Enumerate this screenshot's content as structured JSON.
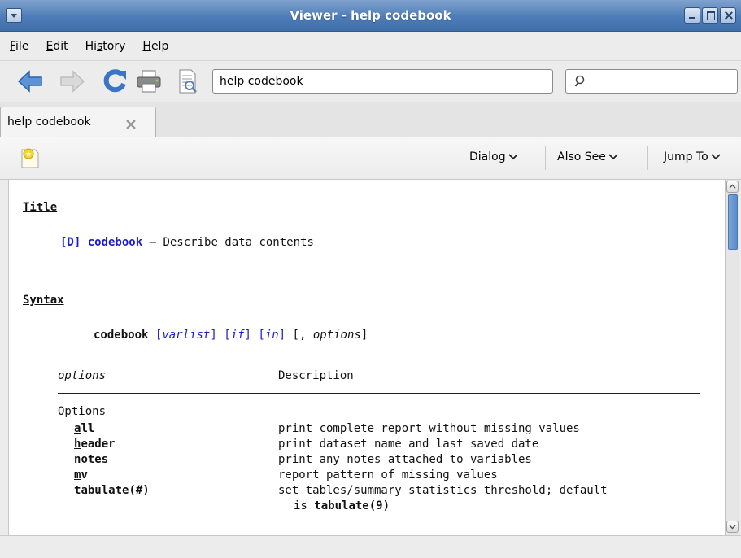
{
  "window": {
    "title": "Viewer - help codebook"
  },
  "menu": [
    {
      "pre": "",
      "key": "F",
      "post": "ile"
    },
    {
      "pre": "",
      "key": "E",
      "post": "dit"
    },
    {
      "pre": "Hi",
      "key": "s",
      "post": "tory"
    },
    {
      "pre": "",
      "key": "H",
      "post": "elp"
    }
  ],
  "toolbar": {
    "url_value": "help codebook",
    "search_value": ""
  },
  "tabs": [
    {
      "label": "help codebook"
    }
  ],
  "subtoolbar": {
    "dialog_label": "Dialog",
    "also_see_label": "Also See",
    "jump_to_label": "Jump To"
  },
  "doc": {
    "title_heading": "Title",
    "title_ref": "[D] codebook",
    "title_desc": "— Describe data contents",
    "syntax_heading": "Syntax",
    "syntax": {
      "cmd": "codebook",
      "open1": "[",
      "varlist": "varlist",
      "close1": "]",
      "open2": "[",
      "if": "if",
      "close2": "]",
      "open3": "[",
      "in": "in",
      "close3": "]",
      "tail_open": "[, ",
      "options": "options",
      "tail_close": "]"
    },
    "table_headers": {
      "col1": "options",
      "col2": "Description"
    },
    "group_label": "Options",
    "options": [
      {
        "key": "a",
        "rest": "ll",
        "desc": "print complete report without missing values"
      },
      {
        "key": "h",
        "rest": "eader",
        "desc": "print dataset name and last saved date"
      },
      {
        "key": "n",
        "rest": "otes",
        "desc": "print any notes attached to variables"
      },
      {
        "key": "m",
        "rest": "v",
        "desc": "report pattern of missing values"
      },
      {
        "key": "t",
        "rest": "abulate(#)",
        "desc": "set tables/summary statistics threshold; default"
      }
    ],
    "continuation_pre": "is ",
    "continuation_bold": "tabulate(9)"
  },
  "colors": {
    "titlebar": "#4e7cb7",
    "link": "#1b1bd2"
  },
  "icons": [
    "back-arrow-icon",
    "forward-arrow-icon",
    "reload-icon",
    "print-icon",
    "view-source-icon",
    "search-icon",
    "tab-close-icon",
    "bookmark-note-icon",
    "chevron-down-icon"
  ]
}
